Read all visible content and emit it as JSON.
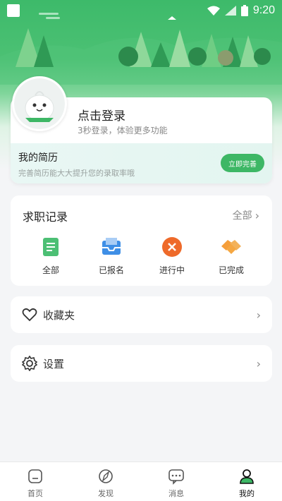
{
  "status_bar": {
    "time": "9:20"
  },
  "profile": {
    "login_title": "点击登录",
    "login_subtitle": "3秒登录，体验更多功能"
  },
  "resume": {
    "title": "我的简历",
    "subtitle": "完善简历能大大提升您的录取率哦",
    "button_label": "立即完善"
  },
  "records": {
    "title": "求职记录",
    "all_link": "全部",
    "items": [
      {
        "label": "全部",
        "icon": "document-icon"
      },
      {
        "label": "已报名",
        "icon": "inbox-icon"
      },
      {
        "label": "进行中",
        "icon": "close-circle-icon"
      },
      {
        "label": "已完成",
        "icon": "handshake-icon"
      }
    ]
  },
  "menu": {
    "favorites": "收藏夹",
    "settings": "设置"
  },
  "tabs": [
    {
      "label": "首页",
      "icon": "home-icon"
    },
    {
      "label": "发现",
      "icon": "compass-icon"
    },
    {
      "label": "消息",
      "icon": "message-icon"
    },
    {
      "label": "我的",
      "icon": "user-icon",
      "active": true
    }
  ],
  "colors": {
    "brand": "#3db765",
    "accent_orange": "#ee6a2a"
  }
}
